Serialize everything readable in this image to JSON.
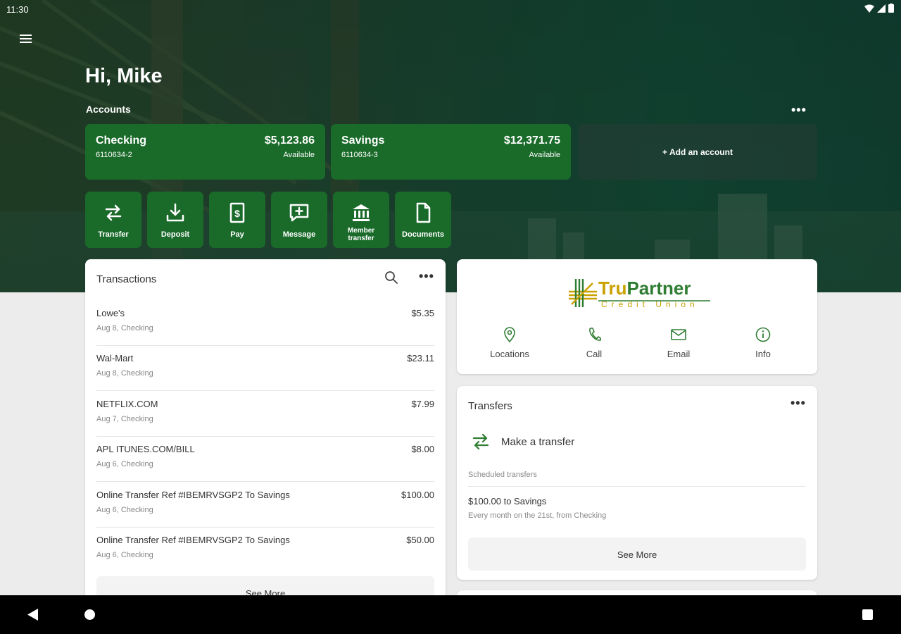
{
  "status_bar": {
    "time": "11:30"
  },
  "header": {
    "greeting": "Hi, Mike",
    "accounts_label": "Accounts",
    "more": "•••"
  },
  "accounts": [
    {
      "name": "Checking",
      "number": "6110634-2",
      "balance": "$5,123.86",
      "balance_label": "Available"
    },
    {
      "name": "Savings",
      "number": "6110634-3",
      "balance": "$12,371.75",
      "balance_label": "Available"
    }
  ],
  "add_account": "+ Add an account",
  "quick_actions": [
    {
      "label": "Transfer",
      "icon": "transfer-icon"
    },
    {
      "label": "Deposit",
      "icon": "deposit-icon"
    },
    {
      "label": "Pay",
      "icon": "pay-icon"
    },
    {
      "label": "Message",
      "icon": "message-icon"
    },
    {
      "label_line1": "Member",
      "label_line2": "transfer",
      "icon": "bank-icon"
    },
    {
      "label": "Documents",
      "icon": "document-icon"
    }
  ],
  "transactions": {
    "title": "Transactions",
    "more": "•••",
    "items": [
      {
        "merchant": "Lowe's",
        "detail": "Aug 8, Checking",
        "amount": "$5.35"
      },
      {
        "merchant": "Wal-Mart",
        "detail": "Aug 8, Checking",
        "amount": "$23.11"
      },
      {
        "merchant": "NETFLIX.COM",
        "detail": "Aug 7, Checking",
        "amount": "$7.99"
      },
      {
        "merchant": "APL ITUNES.COM/BILL",
        "detail": "Aug 6, Checking",
        "amount": "$8.00"
      },
      {
        "merchant": "Online Transfer Ref #IBEMRVSGP2 To Savings",
        "detail": "Aug 6, Checking",
        "amount": "$100.00"
      },
      {
        "merchant": "Online Transfer Ref #IBEMRVSGP2 To Savings",
        "detail": "Aug 6, Checking",
        "amount": "$50.00"
      }
    ],
    "see_more": "See More"
  },
  "credit_union": {
    "logo_name": "TruPartner",
    "logo_sub": "Credit Union",
    "actions": [
      {
        "label": "Locations",
        "icon": "location-pin-icon"
      },
      {
        "label": "Call",
        "icon": "phone-icon"
      },
      {
        "label": "Email",
        "icon": "email-icon"
      },
      {
        "label": "Info",
        "icon": "info-icon"
      }
    ]
  },
  "transfers": {
    "title": "Transfers",
    "more": "•••",
    "make_transfer": "Make a transfer",
    "scheduled_label": "Scheduled transfers",
    "scheduled": [
      {
        "title": "$100.00 to Savings",
        "detail": "Every month on the 21st, from Checking"
      }
    ],
    "see_more": "See More"
  },
  "colors": {
    "brand_green": "#1a6a2a",
    "logo_green": "#2e7d32",
    "logo_gold": "#c9a100",
    "hero_dark": "#143d2c"
  }
}
